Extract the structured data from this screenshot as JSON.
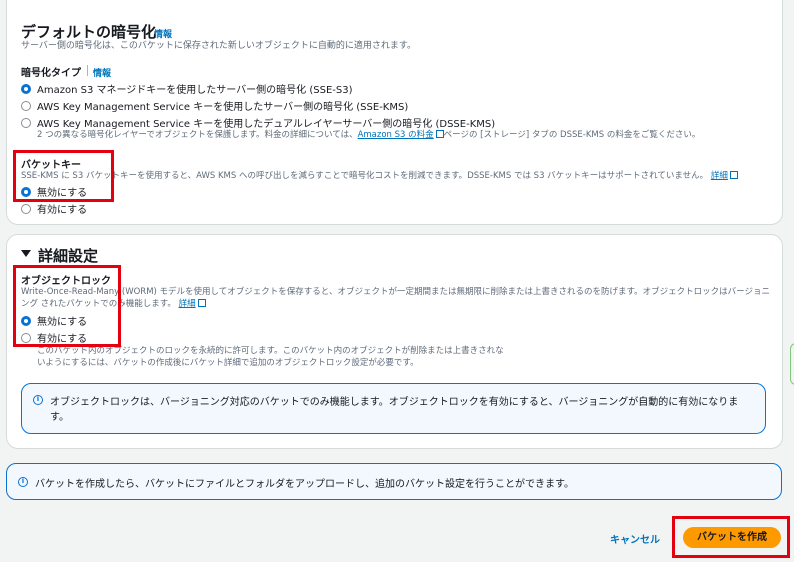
{
  "encryption": {
    "title": "デフォルトの暗号化",
    "title_info": "情報",
    "description": "サーバー側の暗号化は、このバケットに保存された新しいオブジェクトに自動的に適用されます。",
    "type_label": "暗号化タイプ",
    "type_info": "情報",
    "options": [
      {
        "label": "Amazon S3 マネージドキーを使用したサーバー側の暗号化 (SSE-S3)",
        "selected": true
      },
      {
        "label": "AWS Key Management Service キーを使用したサーバー側の暗号化 (SSE-KMS)",
        "selected": false
      },
      {
        "label": "AWS Key Management Service キーを使用したデュアルレイヤーサーバー側の暗号化 (DSSE-KMS)",
        "selected": false
      }
    ],
    "dsse_note_pre": "2 つの異なる暗号化レイヤーでオブジェクトを保護します。料金の詳細については、",
    "dsse_note_link": "Amazon S3 の料金",
    "dsse_note_post": "ページの [ストレージ] タブの DSSE-KMS の料金をご覧ください。",
    "bucket_key": {
      "label": "バケットキー",
      "description": "SSE-KMS に S3 バケットキーを使用すると、AWS KMS への呼び出しを減らすことで暗号化コストを削減できます。DSSE-KMS では S3 バケットキーはサポートされていません。",
      "link": "詳細",
      "options": [
        {
          "label": "無効にする",
          "selected": true
        },
        {
          "label": "有効にする",
          "selected": false
        }
      ]
    }
  },
  "advanced": {
    "title": "詳細設定",
    "object_lock": {
      "label": "オブジェクトロック",
      "description_1": "Write-Once-Read-Many (WORM) モデルを使用してオブジェクトを保存すると、オブジェクトが一定期間または無期限に削除または上書きされるのを防げます。オブジェクトロックはバージョニ",
      "description_2": "ング されたバケットでのみ機能します。",
      "link": "詳細",
      "options": [
        {
          "label": "無効にする",
          "selected": true
        },
        {
          "label": "有効にする",
          "selected": false
        }
      ],
      "hint_1": "このバケット内のオブジェクトのロックを永続的に許可します。このバケット内のオブジェクトが削除または上書きされな",
      "hint_2": "いようにするには、バケットの作成後にバケット詳細で追加のオブジェクトロック設定が必要です。",
      "alert_1": "オブジェクトロックは、バージョニング対応のバケットでのみ機能します。オブジェクトロックを有効にすると、バージョニングが自動的に有効になりま",
      "alert_2": "す。"
    }
  },
  "footer_alert": "バケットを作成したら、バケットにファイルとフォルダをアップロードし、追加のバケット設定を行うことができます。",
  "actions": {
    "cancel": "キャンセル",
    "create": "バケットを作成"
  }
}
